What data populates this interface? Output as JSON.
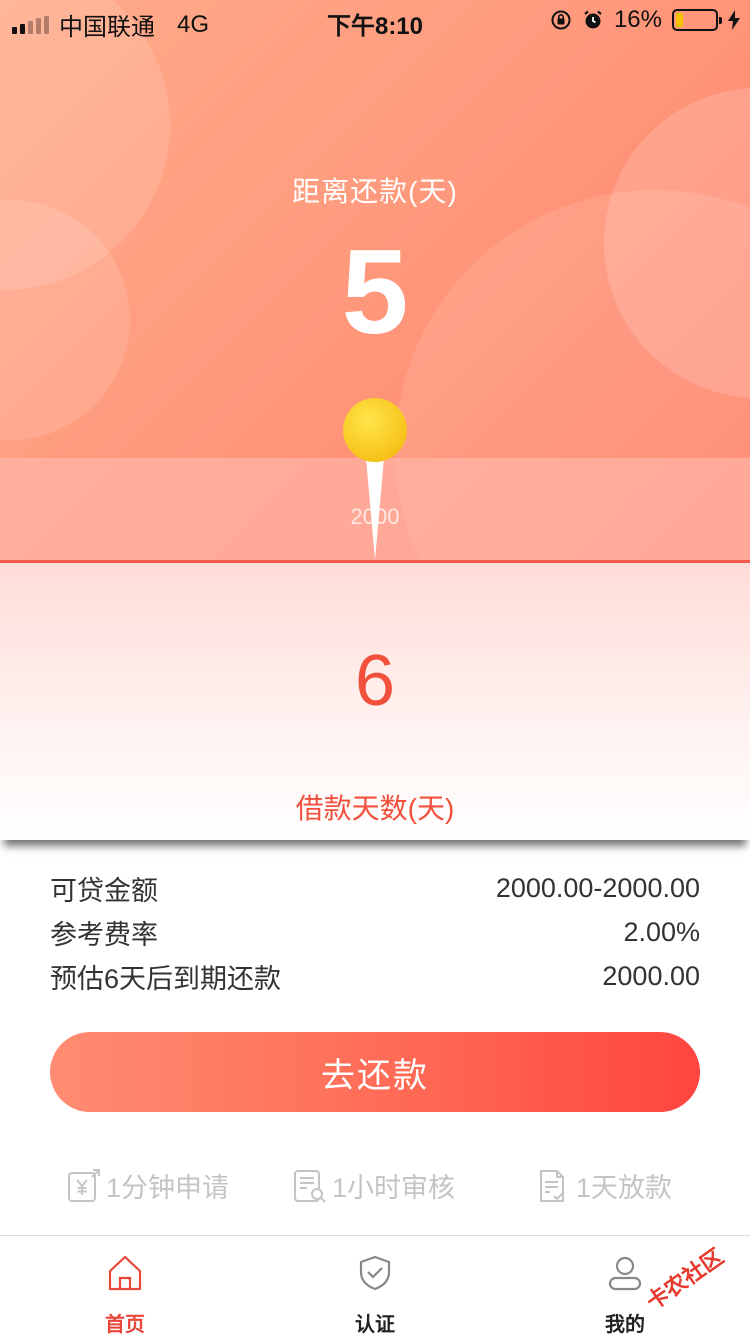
{
  "status_bar": {
    "carrier": "中国联通",
    "network": "4G",
    "time": "下午8:10",
    "battery": "16%"
  },
  "hero": {
    "label": "距离还款(天)",
    "value": "5"
  },
  "slider": {
    "amount": "2000"
  },
  "days": {
    "value": "6",
    "label": "借款天数(天)"
  },
  "info": {
    "rows": [
      {
        "label": "可贷金额",
        "value": "2000.00-2000.00"
      },
      {
        "label": "参考费率",
        "value": "2.00%"
      },
      {
        "label": "预估6天后到期还款",
        "value": "2000.00"
      }
    ]
  },
  "cta": {
    "label": "去还款"
  },
  "features": [
    {
      "label": "1分钟申请",
      "icon": "yen-phone-icon"
    },
    {
      "label": "1小时审核",
      "icon": "document-search-icon"
    },
    {
      "label": "1天放款",
      "icon": "document-check-icon"
    }
  ],
  "tabbar": {
    "items": [
      {
        "label": "首页",
        "icon": "home-icon",
        "active": true
      },
      {
        "label": "认证",
        "icon": "shield-check-icon",
        "active": false
      },
      {
        "label": "我的",
        "icon": "user-icon",
        "active": false
      }
    ]
  },
  "watermark": "卡农社区",
  "colors": {
    "accent": "#f0503c",
    "hero_start": "#ffac8a",
    "hero_end": "#ff8068",
    "knob": "#f7c31a",
    "muted": "#c4c4c4"
  }
}
